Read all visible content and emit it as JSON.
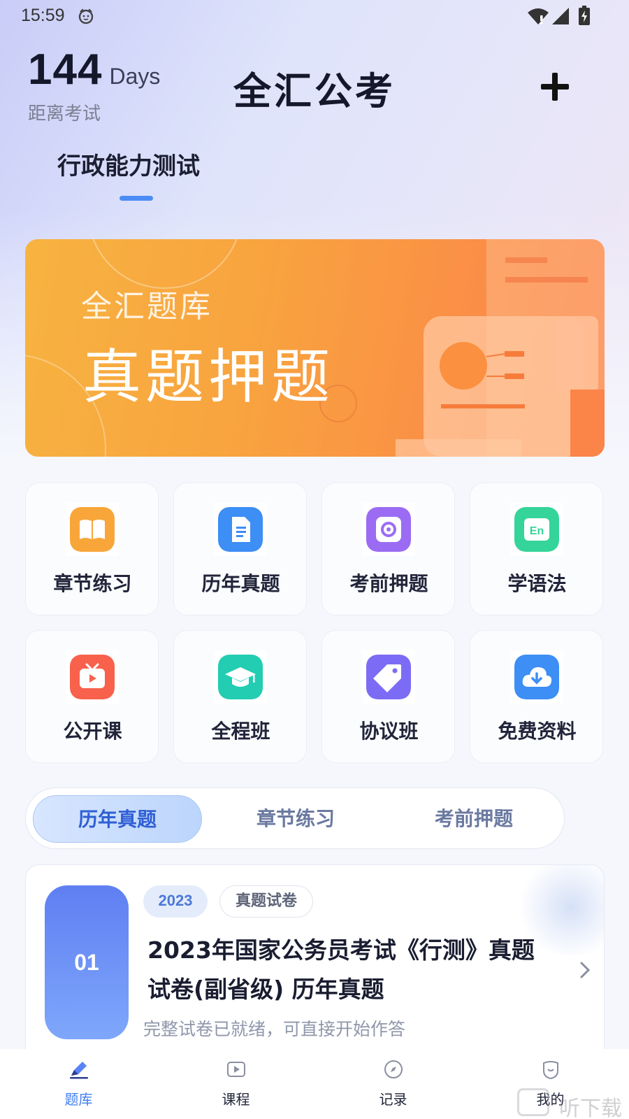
{
  "status_bar": {
    "time": "15:59"
  },
  "header": {
    "days_number": "144",
    "days_unit": "Days",
    "days_caption": "距离考试",
    "app_title": "全汇公考",
    "subject_tab": "行政能力测试"
  },
  "banner": {
    "subtitle": "全汇题库",
    "title": "真题押题"
  },
  "features": [
    {
      "label": "章节练习",
      "icon": "book-icon",
      "color": "#f8a63a"
    },
    {
      "label": "历年真题",
      "icon": "document-icon",
      "color": "#3d8ef5"
    },
    {
      "label": "考前押题",
      "icon": "disc-icon",
      "color": "#9b6cf3"
    },
    {
      "label": "学语法",
      "icon": "english-icon",
      "color": "#34d49a"
    },
    {
      "label": "公开课",
      "icon": "tv-icon",
      "color": "#f8614c"
    },
    {
      "label": "全程班",
      "icon": "graduation-cap-icon",
      "color": "#22cdb2"
    },
    {
      "label": "协议班",
      "icon": "tag-icon",
      "color": "#7c6cf5"
    },
    {
      "label": "免费资料",
      "icon": "cloud-download-icon",
      "color": "#3d8ef5"
    }
  ],
  "segment": {
    "items": [
      "历年真题",
      "章节练习",
      "考前押题"
    ],
    "active": "历年真题"
  },
  "paper": {
    "rank": "01",
    "year_tag": "2023",
    "type_tag": "真题试卷",
    "title": "2023年国家公务员考试《行测》真题试卷(副省级) 历年真题",
    "description": "完整试卷已就绪，可直接开始作答"
  },
  "bottom_nav": {
    "items": [
      {
        "label": "题库",
        "icon": "pencil-icon"
      },
      {
        "label": "课程",
        "icon": "play-icon"
      },
      {
        "label": "记录",
        "icon": "compass-icon"
      },
      {
        "label": "我的",
        "icon": "profile-icon"
      }
    ],
    "active": "题库"
  },
  "watermark": "听下载"
}
